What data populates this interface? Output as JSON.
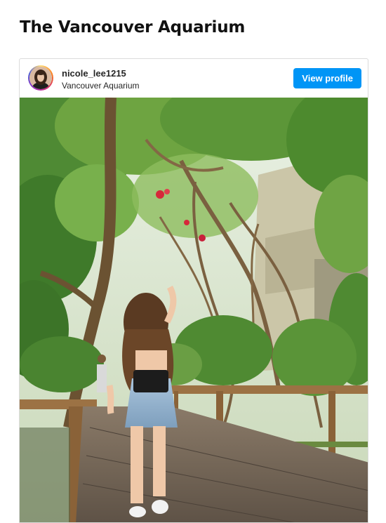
{
  "page": {
    "title": "The Vancouver Aquarium"
  },
  "post": {
    "username": "nicole_lee1215",
    "location": "Vancouver Aquarium",
    "view_profile_label": "View profile",
    "accent_color": "#0095f6",
    "photo_description_icon": "photo"
  }
}
